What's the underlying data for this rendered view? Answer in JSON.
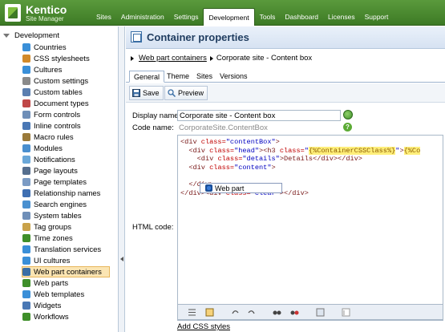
{
  "app": {
    "logo_title": "Kentico",
    "logo_subtitle": "Site Manager",
    "nav_tabs": [
      "Sites",
      "Administration",
      "Settings",
      "Development",
      "Tools",
      "Dashboard",
      "Licenses",
      "Support"
    ],
    "active_nav": "Development"
  },
  "tree": {
    "root_label": "Development",
    "items": [
      {
        "label": "Countries",
        "icon": "globe-icon",
        "color": "#3a8fd8"
      },
      {
        "label": "CSS stylesheets",
        "icon": "brush-icon",
        "color": "#d28a2a"
      },
      {
        "label": "Cultures",
        "icon": "globe-icon",
        "color": "#3a8fd8"
      },
      {
        "label": "Custom settings",
        "icon": "wrench-icon",
        "color": "#8a8a8a"
      },
      {
        "label": "Custom tables",
        "icon": "table-icon",
        "color": "#5b7fb0"
      },
      {
        "label": "Document types",
        "icon": "document-icon",
        "color": "#c04848"
      },
      {
        "label": "Form controls",
        "icon": "form-icon",
        "color": "#6f8fb8"
      },
      {
        "label": "Inline controls",
        "icon": "inline-control-icon",
        "color": "#4a78b5"
      },
      {
        "label": "Macro rules",
        "icon": "macro-icon",
        "color": "#9a7a3a"
      },
      {
        "label": "Modules",
        "icon": "module-icon",
        "color": "#4a8fcf"
      },
      {
        "label": "Notifications",
        "icon": "notification-icon",
        "color": "#6aa7d8"
      },
      {
        "label": "Page layouts",
        "icon": "layout-icon",
        "color": "#556e8e"
      },
      {
        "label": "Page templates",
        "icon": "template-icon",
        "color": "#7b9bc4"
      },
      {
        "label": "Relationship names",
        "icon": "relationship-icon",
        "color": "#3f6fb2"
      },
      {
        "label": "Search engines",
        "icon": "search-engine-icon",
        "color": "#4a90d0"
      },
      {
        "label": "System tables",
        "icon": "system-table-icon",
        "color": "#6f8fb8"
      },
      {
        "label": "Tag groups",
        "icon": "tag-icon",
        "color": "#c9a24a"
      },
      {
        "label": "Time zones",
        "icon": "clock-icon",
        "color": "#3f8f2a"
      },
      {
        "label": "Translation services",
        "icon": "translation-icon",
        "color": "#3a8fd8"
      },
      {
        "label": "UI cultures",
        "icon": "ui-culture-icon",
        "color": "#3a8fd8"
      },
      {
        "label": "Web part containers",
        "icon": "container-icon",
        "color": "#3a6ea5"
      },
      {
        "label": "Web parts",
        "icon": "webpart-icon",
        "color": "#3f8f2a"
      },
      {
        "label": "Web templates",
        "icon": "web-template-icon",
        "color": "#3a8fd8"
      },
      {
        "label": "Widgets",
        "icon": "widget-icon",
        "color": "#4a78b5"
      },
      {
        "label": "Workflows",
        "icon": "workflow-icon",
        "color": "#3f8f2a"
      }
    ],
    "selected_index": 20
  },
  "page": {
    "title": "Container properties",
    "breadcrumb_link": "Web part containers",
    "breadcrumb_current": "Corporate site - Content box",
    "subtabs": [
      "General",
      "Theme",
      "Sites",
      "Versions"
    ],
    "active_subtab": "General",
    "save_label": "Save",
    "preview_label": "Preview",
    "display_name_label": "Display name:",
    "display_name_value": "Corporate site - Content box",
    "code_name_label": "Code name:",
    "code_name_value": "CorporateSite.ContentBox",
    "html_code_label": "HTML code:",
    "web_part_placeholder": "Web part",
    "add_css_label": "Add CSS styles",
    "help_glyph": "?"
  },
  "code_lines": [
    {
      "s1": "<div",
      "a1": " class=",
      "v1": "\"contentBox\"",
      "s2": ">"
    },
    {
      "indent": "  ",
      "s1": "<div",
      "a1": " class=",
      "v1": "\"head\"",
      "s2": "><h3",
      "a2": " class=",
      "v2": "\"",
      "m1": "{%ContainerCSSClass%}",
      "v3": "\"",
      "s3": ">",
      "m2": "{%Co"
    },
    {
      "indent": "    ",
      "s1": "<div",
      "a1": " class=",
      "v1": "\"details\"",
      "s2": ">Details</div></div>"
    },
    {
      "indent": "  ",
      "s1": "<div",
      "a1": " class=",
      "v1": "\"content\"",
      "s2": ">"
    },
    {
      "indent": "",
      "s1": "",
      "a1": "",
      "v1": "",
      "s2": ""
    },
    {
      "indent": "  ",
      "s1": "</div>",
      "a1": "",
      "v1": "",
      "s2": ""
    },
    {
      "indent": "",
      "s1": "</div><div",
      "a1": " class=",
      "v1": "\"clear\"",
      "s2": "></div>"
    }
  ]
}
